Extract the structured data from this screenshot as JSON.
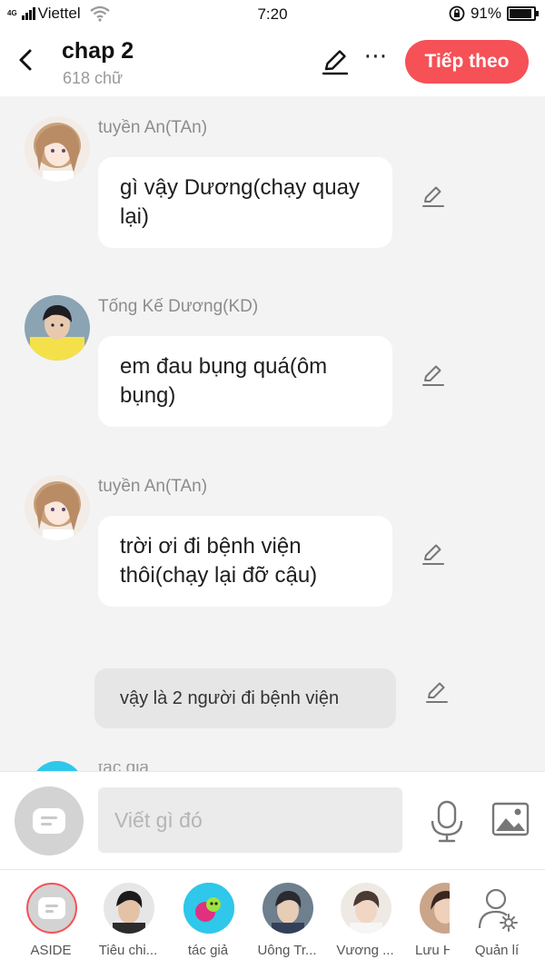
{
  "status_bar": {
    "network": "4G",
    "carrier": "Viettel",
    "time": "7:20",
    "battery": "91%",
    "battery_level": 0.91
  },
  "header": {
    "title": "chap 2",
    "word_count": "618 chữ",
    "next_button": "Tiếp theo",
    "more_glyph": "⋯",
    "icons": [
      "back-arrow-icon",
      "pencil-icon",
      "more-icon"
    ]
  },
  "messages": [
    {
      "sender": "tuyền An(TAn)",
      "text": "gì vậy Dương(chạy quay lại)"
    },
    {
      "sender": "Tống Kế Dương(KD)",
      "text": "em đau bụng quá(ôm bụng)"
    },
    {
      "sender": "tuyền An(TAn)",
      "text": "trời ơi đi bệnh viện thôi(chạy lại đỡ cậu)"
    }
  ],
  "narration": "vậy là 2 người đi bệnh viện",
  "peek_sender": "tác giả",
  "composer": {
    "placeholder": "Viết gì đó",
    "icons": [
      "aside-icon",
      "microphone-icon",
      "image-icon"
    ]
  },
  "characters": [
    {
      "label": "ASIDE"
    },
    {
      "label": "Tiêu chi..."
    },
    {
      "label": "tác giả"
    },
    {
      "label": "Uông Tr..."
    },
    {
      "label": "Vương ..."
    },
    {
      "label": "Lưu H"
    },
    {
      "label": "Quản lí"
    }
  ],
  "colors": {
    "accent": "#f55157",
    "background": "#f3f3f3",
    "bubble": "#ffffff",
    "narration_bubble": "#e6e6e6",
    "author_avatar": "#2fc7ea"
  }
}
